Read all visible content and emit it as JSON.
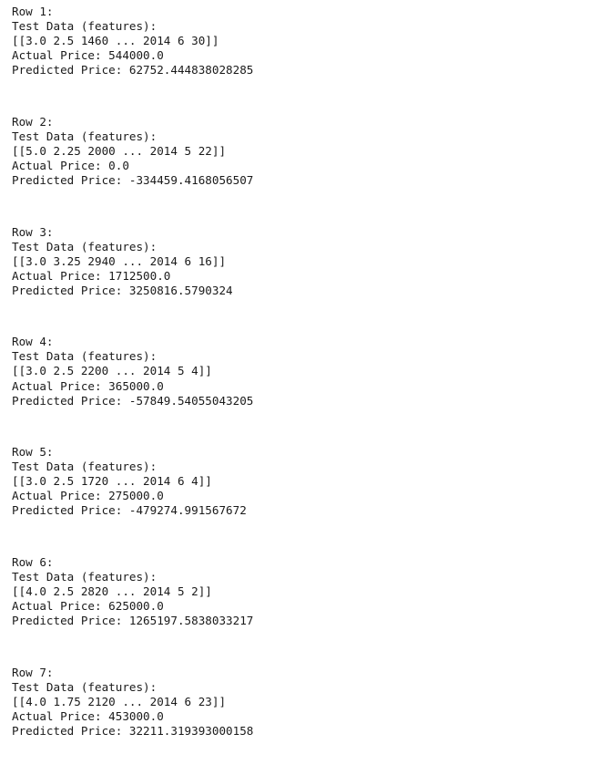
{
  "output": {
    "rows": [
      {
        "row_label": "Row 1:",
        "features_label": "Test Data (features):",
        "features": "[[3.0 2.5 1460 ... 2014 6 30]]",
        "actual": "Actual Price: 544000.0",
        "predicted": "Predicted Price: 62752.444838028285"
      },
      {
        "row_label": "Row 2:",
        "features_label": "Test Data (features):",
        "features": "[[5.0 2.25 2000 ... 2014 5 22]]",
        "actual": "Actual Price: 0.0",
        "predicted": "Predicted Price: -334459.4168056507"
      },
      {
        "row_label": "Row 3:",
        "features_label": "Test Data (features):",
        "features": "[[3.0 3.25 2940 ... 2014 6 16]]",
        "actual": "Actual Price: 1712500.0",
        "predicted": "Predicted Price: 3250816.5790324"
      },
      {
        "row_label": "Row 4:",
        "features_label": "Test Data (features):",
        "features": "[[3.0 2.5 2200 ... 2014 5 4]]",
        "actual": "Actual Price: 365000.0",
        "predicted": "Predicted Price: -57849.54055043205"
      },
      {
        "row_label": "Row 5:",
        "features_label": "Test Data (features):",
        "features": "[[3.0 2.5 1720 ... 2014 6 4]]",
        "actual": "Actual Price: 275000.0",
        "predicted": "Predicted Price: -479274.991567672"
      },
      {
        "row_label": "Row 6:",
        "features_label": "Test Data (features):",
        "features": "[[4.0 2.5 2820 ... 2014 5 2]]",
        "actual": "Actual Price: 625000.0",
        "predicted": "Predicted Price: 1265197.5838033217"
      },
      {
        "row_label": "Row 7:",
        "features_label": "Test Data (features):",
        "features": "[[4.0 1.75 2120 ... 2014 6 23]]",
        "actual": "Actual Price: 453000.0",
        "predicted": "Predicted Price: 32211.319393000158"
      }
    ]
  }
}
